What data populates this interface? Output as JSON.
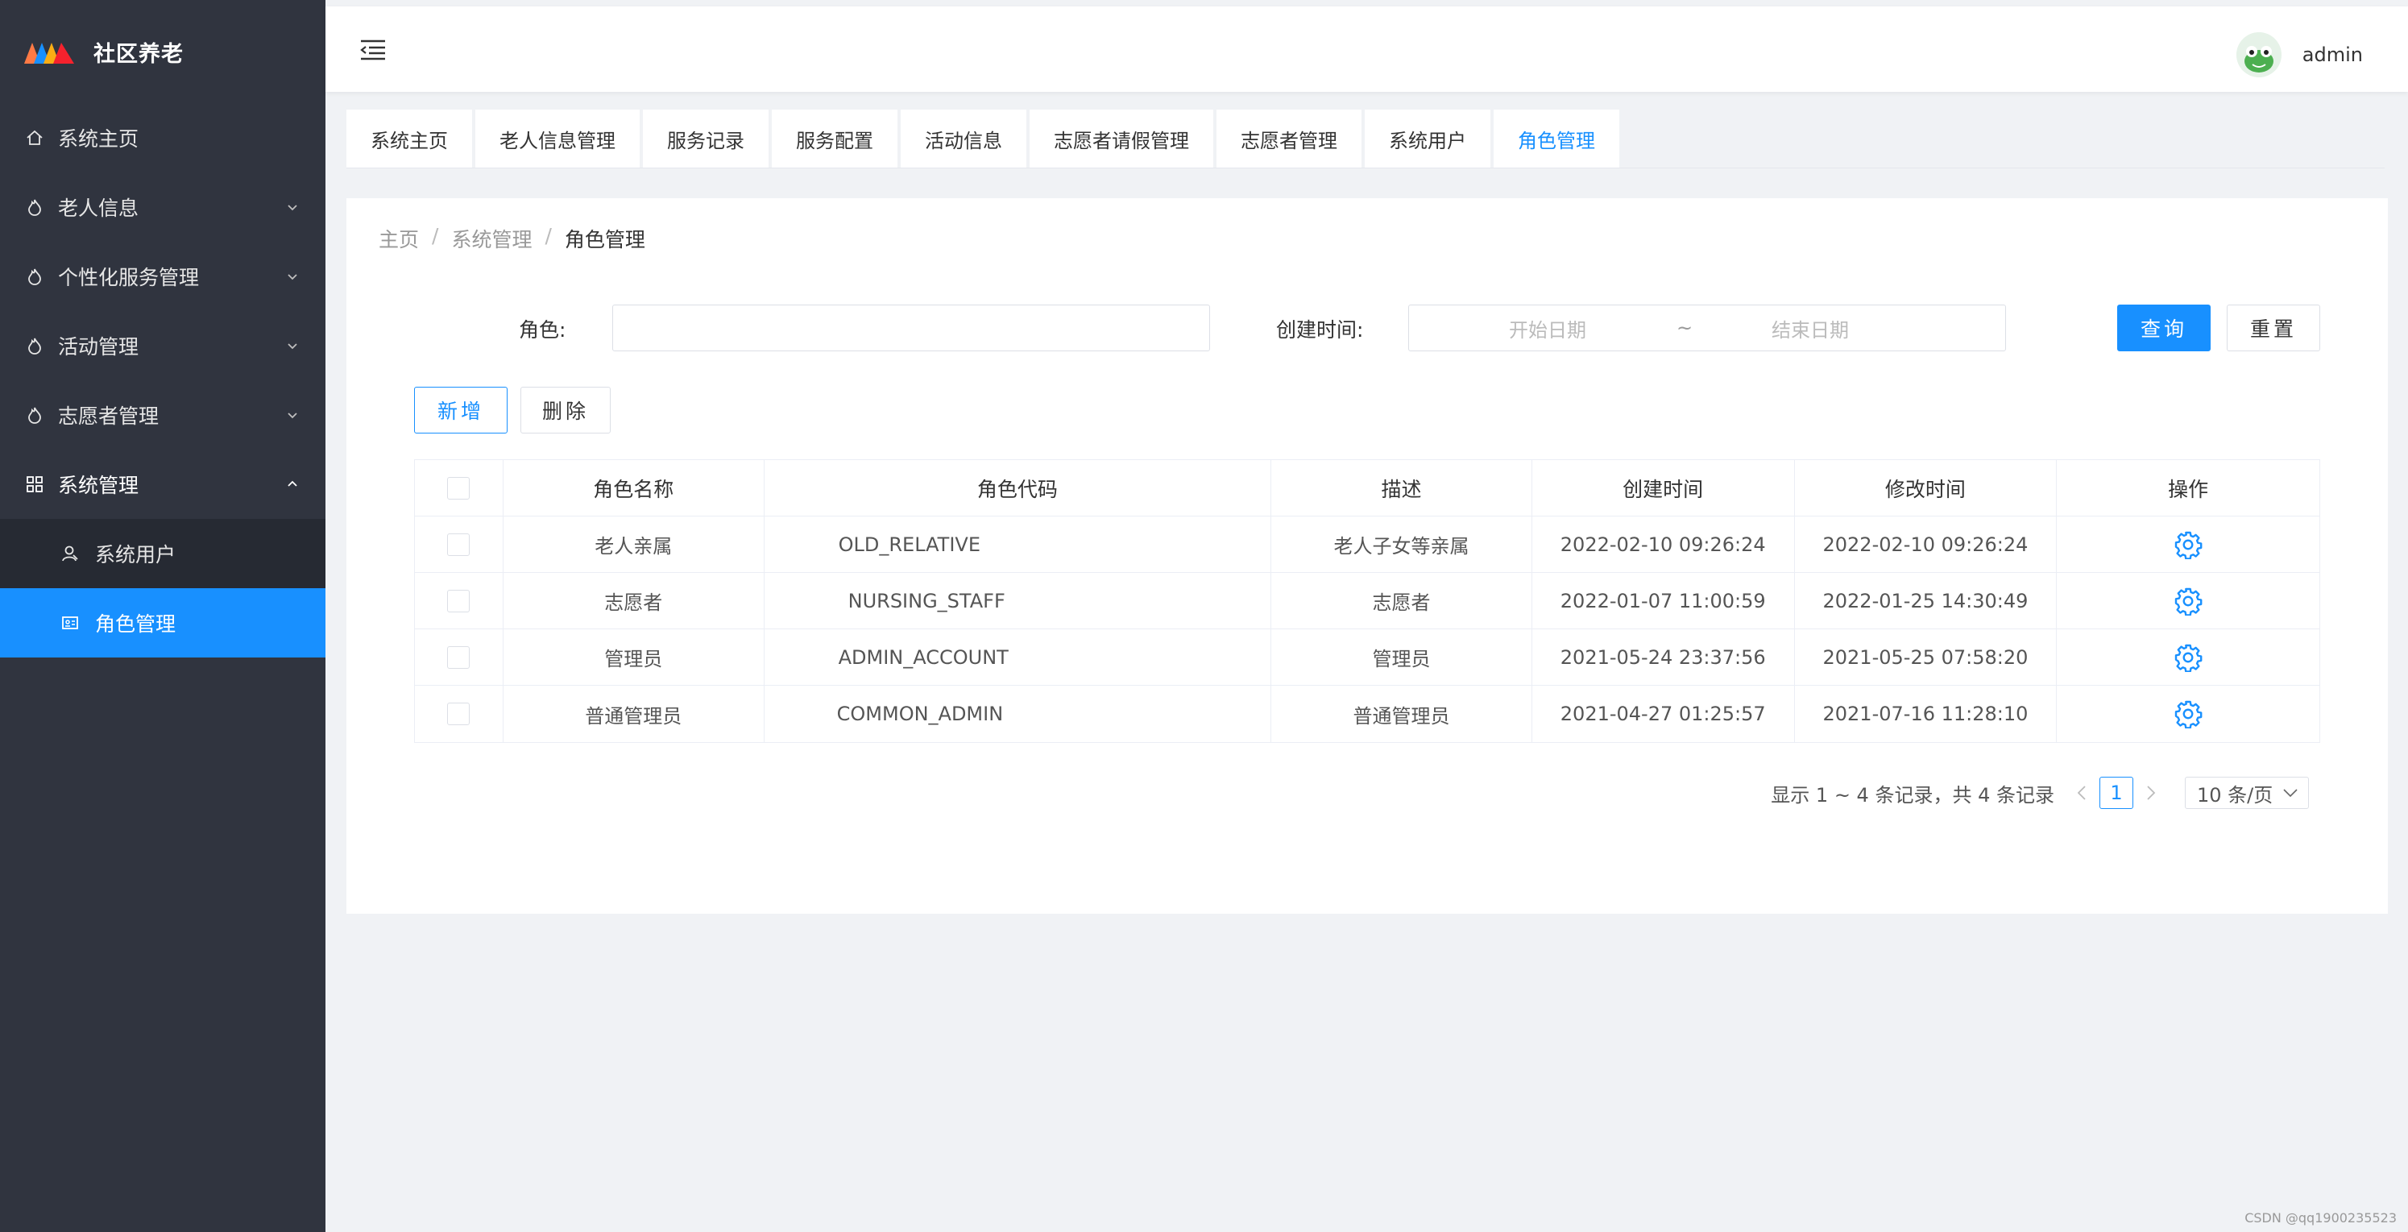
{
  "brand": {
    "title": "社区养老"
  },
  "sidebar": {
    "items": [
      {
        "label": "系统主页",
        "icon": "home-icon"
      },
      {
        "label": "老人信息",
        "icon": "flame-icon",
        "has_children": true
      },
      {
        "label": "个性化服务管理",
        "icon": "flame-icon",
        "has_children": true
      },
      {
        "label": "活动管理",
        "icon": "flame-icon",
        "has_children": true
      },
      {
        "label": "志愿者管理",
        "icon": "flame-icon",
        "has_children": true
      },
      {
        "label": "系统管理",
        "icon": "grid-icon",
        "has_children": true,
        "expanded": true
      }
    ],
    "sub_items": [
      {
        "label": "系统用户",
        "icon": "user-icon"
      },
      {
        "label": "角色管理",
        "icon": "id-card-icon",
        "active": true
      }
    ],
    "background": "#30343f",
    "active_color": "#1890ff"
  },
  "header": {
    "username": "admin"
  },
  "tabs": [
    "系统主页",
    "老人信息管理",
    "服务记录",
    "服务配置",
    "活动信息",
    "志愿者请假管理",
    "志愿者管理",
    "系统用户",
    "角色管理"
  ],
  "breadcrumb": [
    "主页",
    "系统管理",
    "角色管理"
  ],
  "breadcrumb_sep": "/",
  "search": {
    "role_label": "角色:",
    "role_value": "",
    "created_label": "创建时间:",
    "start_placeholder": "开始日期",
    "range_sep": "~",
    "end_placeholder": "结束日期",
    "query_label": "查询",
    "reset_label": "重置"
  },
  "actions": {
    "add_label": "新增",
    "delete_label": "删除"
  },
  "table": {
    "headers": [
      "角色名称",
      "角色代码",
      "描述",
      "创建时间",
      "修改时间",
      "操作"
    ],
    "rows": [
      {
        "name": "老人亲属",
        "code": "OLD_RELATIVE",
        "desc": "老人子女等亲属",
        "created": "2022-02-10 09:26:24",
        "modified": "2022-02-10 09:26:24"
      },
      {
        "name": "志愿者",
        "code": "NURSING_STAFF",
        "desc": "志愿者",
        "created": "2022-01-07 11:00:59",
        "modified": "2022-01-25 14:30:49"
      },
      {
        "name": "管理员",
        "code": "ADMIN_ACCOUNT",
        "desc": "管理员",
        "created": "2021-05-24 23:37:56",
        "modified": "2021-05-25 07:58:20"
      },
      {
        "name": "普通管理员",
        "code": "COMMON_ADMIN",
        "desc": "普通管理员",
        "created": "2021-04-27 01:25:57",
        "modified": "2021-07-16 11:28:10"
      }
    ]
  },
  "pagination": {
    "summary": "显示 1 ~ 4 条记录，共 4 条记录",
    "current_page": "1",
    "page_size": "10 条/页"
  },
  "watermark": "CSDN @qq1900235523",
  "colors": {
    "primary": "#1890ff",
    "page_bg": "#f0f2f5"
  }
}
